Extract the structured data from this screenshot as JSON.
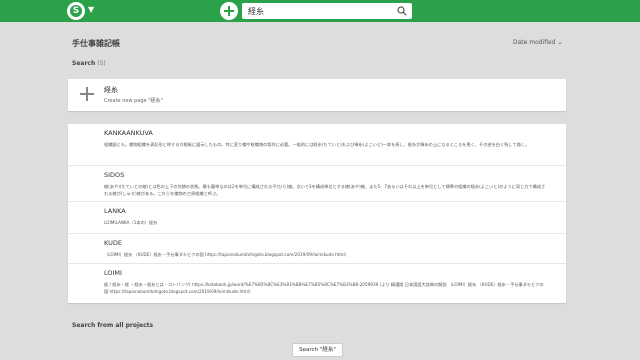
{
  "header": {
    "logo_letter": "S",
    "search_value": "経糸"
  },
  "project": {
    "title": "手仕事雑記帳",
    "sort_label": "Date modified"
  },
  "search": {
    "heading": "Search",
    "count": "(5)"
  },
  "new_page": {
    "title": "経糸",
    "subtitle": "Create new page \"経糸\""
  },
  "results": [
    {
      "title": "KANKAANKUVA",
      "desc": "組織図とも。織物組織を表記形と称する方眼紙に図示したもの。特に変り織や紋織物の製作に必要。一般的には経糸(たていと)および緯糸(よこいと)一本を表し、経糸が緯糸の上になるところを黒く、その逆を白く残して描く。"
    },
    {
      "title": "SIDOS",
      "desc": "綾(あや)(たていとの綾)とは色の上下の交錯の状態。最も簡単なのは2を単位に構成される平(ひら)綾。次いで3を構成単位とする綾(あや)綾、また5、7あるいはそれ以上を単位として標準の組織の経糸(よこいと)のように同じ方で構成される綾が(しゅす)綾がある。これらを織物の三原組織と呼ぶ。"
    },
    {
      "title": "LANKA",
      "desc": "LOIMILANKA（1本の）経糸"
    },
    {
      "title": "KUDE",
      "desc": "（LOIMI）経糸 （KUDE）経糸・手仕事ダキビクの国 https://tapionokumitohigoto.blogspot.com/2019/09/loimikude.html）"
    },
    {
      "title": "LOIMI",
      "desc": "経 / 経糸・経 ・経糸・経糸とは - コトバンク( https://kotobank.jp/word/%E7%B5%8C%E3%83%BB%E7%B5%8C%E7%B3%B8-2059939 )より 精選版 日本国語大辞典の解説 （LOIMI）経糸 （KUDE）経糸・手仕事ダキビクの国 https://tapionokumitohigoto.blogspot.com/2019/09/loimikude.html）"
    }
  ],
  "footer": {
    "all_projects_heading": "Search from all projects",
    "search_button": "Search \"経糸\""
  }
}
